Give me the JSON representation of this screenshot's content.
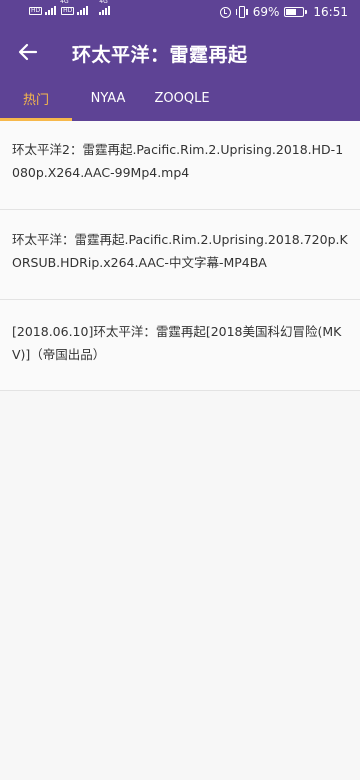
{
  "status_bar": {
    "net_tags": [
      "HD",
      "HD"
    ],
    "sig_tags": [
      "4G",
      "4G"
    ],
    "battery": "69%",
    "battery_level": 0.69,
    "time": "16:51"
  },
  "toolbar": {
    "back_icon": "arrow-left-icon",
    "title": "环太平洋：雷霆再起"
  },
  "tabs": [
    {
      "label": "热门",
      "active": true
    },
    {
      "label": "NYAA",
      "active": false
    },
    {
      "label": "ZOOQLE",
      "active": false
    }
  ],
  "results": [
    {
      "title": "环太平洋2：雷霆再起.Pacific.Rim.2.Uprising.2018.HD-1080p.X264.AAC-99Mp4.mp4"
    },
    {
      "title": "环太平洋：雷霆再起.Pacific.Rim.2.Uprising.2018.720p.KORSUB.HDRip.x264.AAC-中文字幕-MP4BA"
    },
    {
      "title": "[2018.06.10]环太平洋：雷霆再起[2018美国科幻冒险(MKV)]（帝国出品）"
    }
  ],
  "colors": {
    "header": "#5e4395",
    "accent": "#f7b84b",
    "background": "#f7f7f7"
  }
}
